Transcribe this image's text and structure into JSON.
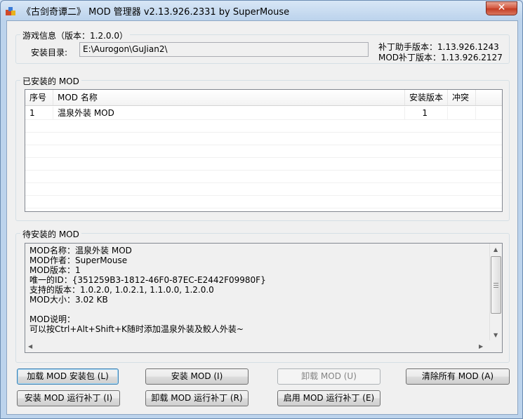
{
  "window": {
    "title": "《古剑奇谭二》 MOD 管理器 v2.13.926.2331 by SuperMouse",
    "close_label": "✕"
  },
  "game_info": {
    "group_title": "游戏信息（版本：1.2.0.0）",
    "install_dir_label": "安装目录:",
    "install_dir_value": "E:\\Aurogon\\GuJian2\\",
    "patch_helper_version": "补丁助手版本：1.13.926.1243",
    "mod_patch_version": "MOD补丁版本：1.13.926.2127"
  },
  "installed": {
    "group_title": "已安装的 MOD",
    "columns": [
      "序号",
      "MOD 名称",
      "安装版本",
      "冲突"
    ],
    "rows": [
      {
        "index": "1",
        "name": "温泉外装 MOD",
        "version": "1",
        "conflict": ""
      }
    ]
  },
  "pending": {
    "group_title": "待安装的 MOD",
    "lines": [
      "MOD名称：温泉外装 MOD",
      "MOD作者：SuperMouse",
      "MOD版本：1",
      "唯一的ID：{351259B3-1812-46F0-87EC-E2442F09980F}",
      "支持的版本：1.0.2.0, 1.0.2.1, 1.1.0.0, 1.2.0.0",
      "MOD大小：3.02 KB",
      "",
      "MOD说明：",
      "可以按Ctrl+Alt+Shift+K随时添加温泉外装及鲛人外装~"
    ]
  },
  "buttons": {
    "load_package": "加载 MOD 安装包 (L)",
    "install": "安装 MOD (I)",
    "uninstall": "卸载 MOD (U)",
    "clear_all": "清除所有 MOD (A)",
    "install_runtime_patch": "安装 MOD 运行补丁 (I)",
    "uninstall_runtime_patch": "卸载 MOD 运行补丁 (R)",
    "enable_runtime_patch": "启用 MOD 运行补丁 (E)"
  }
}
